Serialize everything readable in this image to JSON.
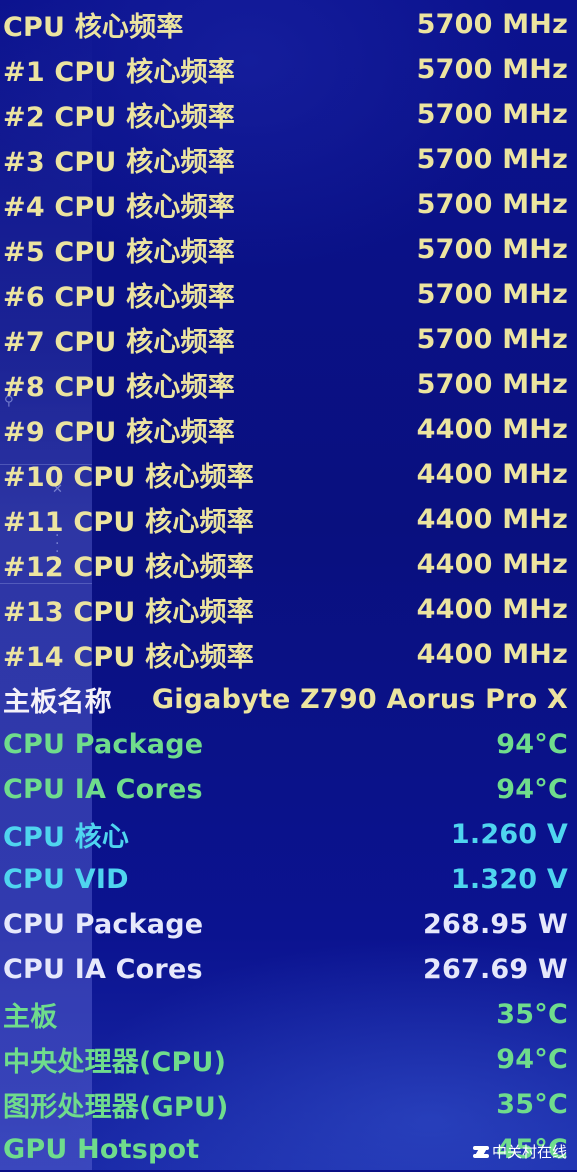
{
  "rows": [
    {
      "label": "CPU 核心频率",
      "value": "5700 MHz",
      "color": "yellow"
    },
    {
      "label": "#1 CPU 核心频率",
      "value": "5700 MHz",
      "color": "yellow"
    },
    {
      "label": "#2 CPU 核心频率",
      "value": "5700 MHz",
      "color": "yellow"
    },
    {
      "label": "#3 CPU 核心频率",
      "value": "5700 MHz",
      "color": "yellow"
    },
    {
      "label": "#4 CPU 核心频率",
      "value": "5700 MHz",
      "color": "yellow"
    },
    {
      "label": "#5 CPU 核心频率",
      "value": "5700 MHz",
      "color": "yellow"
    },
    {
      "label": "#6 CPU 核心频率",
      "value": "5700 MHz",
      "color": "yellow"
    },
    {
      "label": "#7 CPU 核心频率",
      "value": "5700 MHz",
      "color": "yellow"
    },
    {
      "label": "#8 CPU 核心频率",
      "value": "5700 MHz",
      "color": "yellow"
    },
    {
      "label": "#9 CPU 核心频率",
      "value": "4400 MHz",
      "color": "yellow"
    },
    {
      "label": "#10 CPU 核心频率",
      "value": "4400 MHz",
      "color": "yellow"
    },
    {
      "label": "#11 CPU 核心频率",
      "value": "4400 MHz",
      "color": "yellow"
    },
    {
      "label": "#12 CPU 核心频率",
      "value": "4400 MHz",
      "color": "yellow"
    },
    {
      "label": "#13 CPU 核心频率",
      "value": "4400 MHz",
      "color": "yellow"
    },
    {
      "label": "#14 CPU 核心频率",
      "value": "4400 MHz",
      "color": "yellow"
    },
    {
      "label": "主板名称",
      "value": "Gigabyte Z790 Aorus Pro X",
      "color": "white",
      "value_color": "yellow"
    },
    {
      "label": "CPU Package",
      "value": "94°C",
      "color": "green"
    },
    {
      "label": "CPU IA Cores",
      "value": "94°C",
      "color": "green"
    },
    {
      "label": "CPU 核心",
      "value": "1.260 V",
      "color": "cyan"
    },
    {
      "label": "CPU VID",
      "value": "1.320 V",
      "color": "cyan"
    },
    {
      "label": "CPU Package",
      "value": "268.95 W",
      "color": "lav"
    },
    {
      "label": "CPU IA Cores",
      "value": "267.69 W",
      "color": "lav"
    },
    {
      "label": "主板",
      "value": "35°C",
      "color": "green"
    },
    {
      "label": "中央处理器(CPU)",
      "value": "94°C",
      "color": "green"
    },
    {
      "label": "图形处理器(GPU)",
      "value": "35°C",
      "color": "green"
    },
    {
      "label": "GPU Hotspot",
      "value": "45°C",
      "color": "green"
    }
  ],
  "colors": {
    "yellow": "#ece4a0",
    "white": "#f4f1f8",
    "green": "#6fdc8c",
    "cyan": "#4fd5ef",
    "lav": "#e6e8fb",
    "background": "#0a0f86"
  },
  "watermark": {
    "text": "中关村在线",
    "icon": "zol-logo-icon"
  },
  "side_panel": {
    "icons": [
      "search-icon",
      "close-icon",
      "more-vertical-icon"
    ]
  }
}
